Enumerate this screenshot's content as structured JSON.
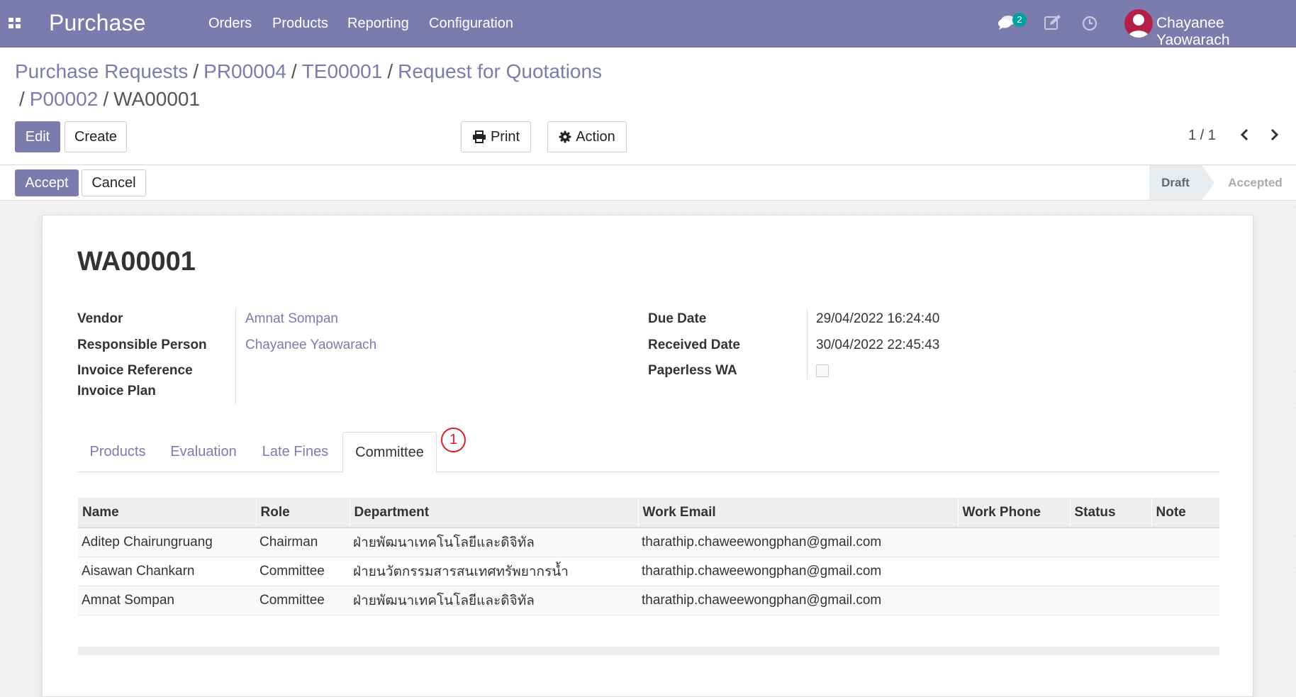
{
  "navbar": {
    "app_name": "Purchase",
    "menu": [
      "Orders",
      "Products",
      "Reporting",
      "Configuration"
    ],
    "chat_badge": "2",
    "user_name": "Chayanee Yaowarach",
    "colors": {
      "brand": "#7c7bad",
      "badge": "#00a09d",
      "avatar": "#b51f45"
    }
  },
  "breadcrumb": {
    "line1": [
      "Purchase Requests",
      "PR00004",
      "TE00001",
      "Request for Quotations"
    ],
    "line2": [
      "P00002"
    ],
    "current": "WA00001",
    "separator": "/"
  },
  "buttons": {
    "edit": "Edit",
    "create": "Create",
    "print": "Print",
    "action": "Action",
    "accept": "Accept",
    "cancel": "Cancel"
  },
  "pager": {
    "value": "1 / 1"
  },
  "status": {
    "stages": [
      "Draft",
      "Accepted"
    ],
    "current": "Draft"
  },
  "record": {
    "title": "WA00001",
    "left_fields": [
      {
        "label": "Vendor",
        "value": "Amnat Sompan"
      },
      {
        "label": "Responsible Person",
        "value": "Chayanee Yaowarach"
      },
      {
        "label": "Invoice Reference",
        "value": ""
      },
      {
        "label": "Invoice Plan",
        "value": ""
      }
    ],
    "right_fields": [
      {
        "label": "Due Date",
        "value": "29/04/2022 16:24:40"
      },
      {
        "label": "Received Date",
        "value": "30/04/2022 22:45:43"
      },
      {
        "label": "Paperless WA",
        "value": false
      }
    ]
  },
  "tabs": [
    "Products",
    "Evaluation",
    "Late Fines",
    "Committee"
  ],
  "active_tab": "Committee",
  "annotation": "1",
  "committee_table": {
    "columns": [
      "Name",
      "Role",
      "Department",
      "Work Email",
      "Work Phone",
      "Status",
      "Note"
    ],
    "rows": [
      [
        "Aditep Chairungruang",
        "Chairman",
        "ฝ่ายพัฒนาเทคโนโลยีและดิจิทัล",
        "tharathip.chaweewongphan@gmail.com",
        "",
        "",
        ""
      ],
      [
        "Aisawan Chankarn",
        "Committee",
        "ฝ่ายนวัตกรรมสารสนเทศทรัพยากรน้ำ",
        "tharathip.chaweewongphan@gmail.com",
        "",
        "",
        ""
      ],
      [
        "Amnat Sompan",
        "Committee",
        "ฝ่ายพัฒนาเทคโนโลยีและดิจิทัล",
        "tharathip.chaweewongphan@gmail.com",
        "",
        "",
        ""
      ]
    ]
  }
}
